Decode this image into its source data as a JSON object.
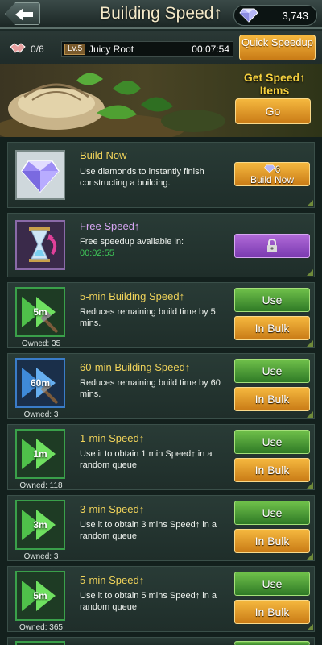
{
  "header": {
    "title": "Building Speed↑",
    "gems": "3,743"
  },
  "infobar": {
    "queue": "0/6",
    "level": "Lv.5",
    "task_name": "Juicy Root",
    "task_time": "00:07:54",
    "quick_speedup": "Quick Speedup"
  },
  "banner": {
    "label": "Get Speed↑ Items",
    "go": "Go"
  },
  "items": [
    {
      "title": "Build Now",
      "desc": "Use diamonds to instantly finish constructing a building.",
      "cost": "6",
      "button": "Build Now",
      "icon": "diamond-icon"
    },
    {
      "title": "Free Speed↑",
      "desc": "Free speedup available in:",
      "timer": "00:02:55",
      "icon": "hourglass-icon",
      "button_icon": "lock-icon"
    },
    {
      "title": "5-min Building Speed↑",
      "desc": "Reduces remaining build time by 5 mins.",
      "icon_label": "5m",
      "owned": "Owned: 35",
      "use": "Use",
      "bulk": "In Bulk"
    },
    {
      "title": "60-min Building Speed↑",
      "desc": "Reduces remaining build time by 60 mins.",
      "icon_label": "60m",
      "owned": "Owned: 3",
      "use": "Use",
      "bulk": "In Bulk"
    },
    {
      "title": "1-min Speed↑",
      "desc": "Use it to obtain 1 min Speed↑ in a random queue",
      "icon_label": "1m",
      "owned": "Owned: 118",
      "use": "Use",
      "bulk": "In Bulk"
    },
    {
      "title": "3-min Speed↑",
      "desc": "Use it to obtain 3 mins Speed↑ in a random queue",
      "icon_label": "3m",
      "owned": "Owned: 3",
      "use": "Use",
      "bulk": "In Bulk"
    },
    {
      "title": "5-min Speed↑",
      "desc": "Use it to obtain 5 mins Speed↑ in a random queue",
      "icon_label": "5m",
      "owned": "Owned: 365",
      "use": "Use",
      "bulk": "In Bulk"
    }
  ],
  "colors": {
    "accent_gold": "#f6d13e",
    "button_green": "#4a9a36",
    "button_orange": "#e39a28",
    "button_purple": "#9a52c8",
    "timer_green": "#3fc858"
  }
}
